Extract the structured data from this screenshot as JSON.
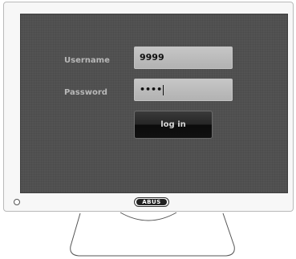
{
  "login": {
    "username_label": "Username",
    "username_value": "9999",
    "password_label": "Password",
    "password_value": "••••",
    "submit_label": "log in"
  },
  "device": {
    "brand": "ABUS"
  },
  "colors": {
    "screen_bg": "#535353",
    "field_bg": "#bcbcbc",
    "button_bg": "#1a1a1a",
    "label_text": "#b8b8b8"
  }
}
